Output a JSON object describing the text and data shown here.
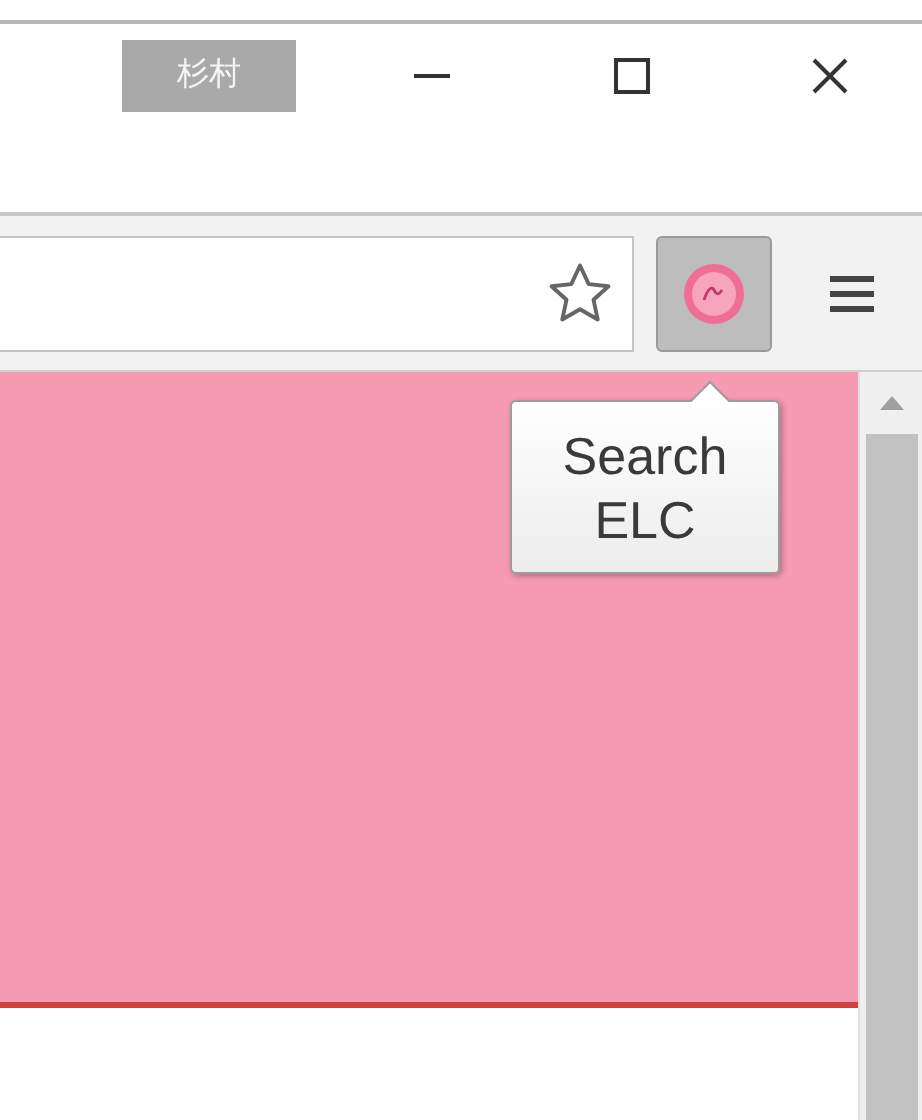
{
  "title_bar": {
    "profile_name": "杉村"
  },
  "toolbar": {
    "extension_button": {
      "pressed": true
    }
  },
  "tooltip": {
    "lines": [
      "Search",
      "ELC"
    ]
  }
}
